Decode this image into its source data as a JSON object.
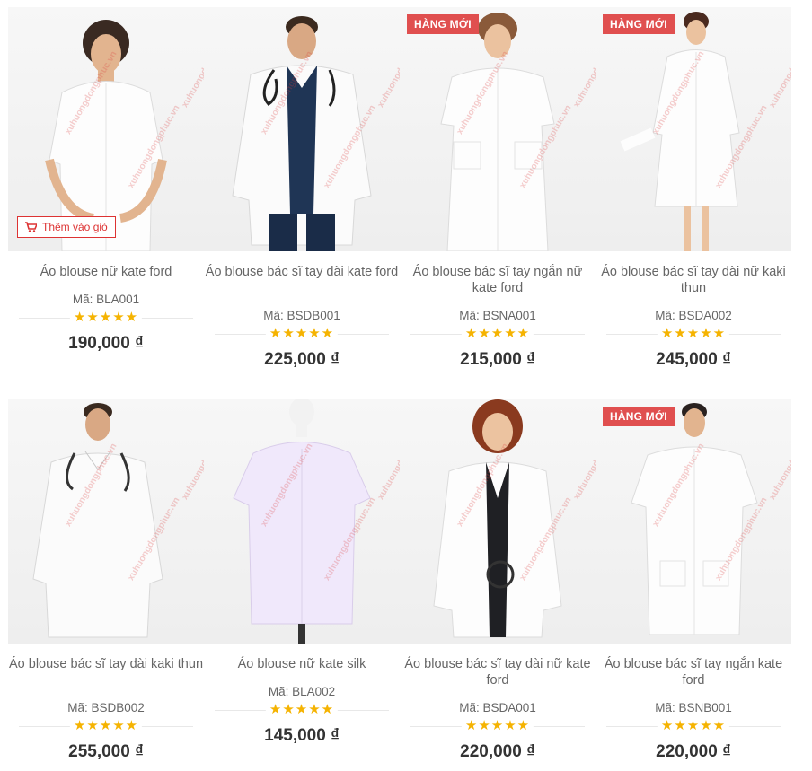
{
  "watermark_text": "xuhuongdongphuc.vn",
  "badge_label": "HÀNG MỚI",
  "cart_button_label": "Thêm vào giỏ",
  "stars": "★★★★★",
  "colors": {
    "accent_red": "#e04f4f",
    "star_yellow": "#f5b301",
    "price": "#333333"
  },
  "products": [
    {
      "name": "Áo blouse nữ kate ford",
      "code": "Mã: BLA001",
      "price": "190,000 ₫",
      "badge": false,
      "cart": true
    },
    {
      "name": "Áo blouse bác sĩ tay dài kate ford",
      "code": "Mã: BSDB001",
      "price": "225,000 ₫",
      "badge": false,
      "cart": false
    },
    {
      "name": "Áo blouse bác sĩ tay ngắn nữ kate ford",
      "code": "Mã: BSNA001",
      "price": "215,000 ₫",
      "badge": true,
      "cart": false
    },
    {
      "name": "Áo blouse bác sĩ tay dài nữ kaki thun",
      "code": "Mã: BSDA002",
      "price": "245,000 ₫",
      "badge": true,
      "cart": false
    },
    {
      "name": "Áo blouse bác sĩ tay dài kaki thun",
      "code": "Mã: BSDB002",
      "price": "255,000 ₫",
      "badge": false,
      "cart": false
    },
    {
      "name": "Áo blouse nữ kate silk",
      "code": "Mã: BLA002",
      "price": "145,000 ₫",
      "badge": false,
      "cart": false
    },
    {
      "name": "Áo blouse bác sĩ tay dài nữ kate ford",
      "code": "Mã: BSDA001",
      "price": "220,000 ₫",
      "badge": false,
      "cart": false
    },
    {
      "name": "Áo blouse bác sĩ tay ngắn kate ford",
      "code": "Mã: BSNB001",
      "price": "220,000 ₫",
      "badge": true,
      "cart": false
    }
  ]
}
